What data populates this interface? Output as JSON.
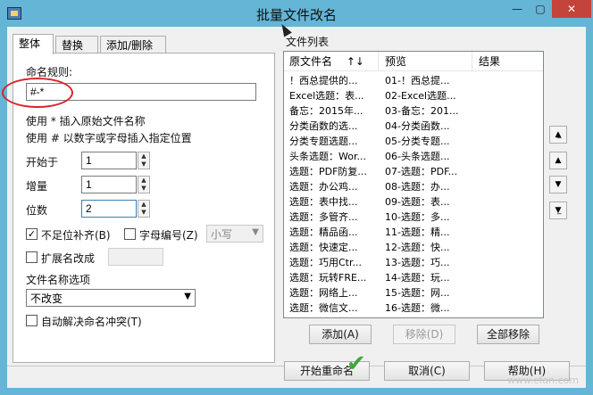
{
  "window": {
    "title": "批量文件改名",
    "min": "—",
    "max": "▢",
    "close": "✕"
  },
  "tabs": [
    "整体",
    "替换",
    "添加/删除"
  ],
  "left": {
    "rule_label": "命名规则:",
    "rule_value": "#-*",
    "hint1": "使用 * 插入原始文件名称",
    "hint2": "使用 # 以数字或字母插入指定位置",
    "start_label": "开始于",
    "start_value": "1",
    "step_label": "增量",
    "step_value": "1",
    "digits_label": "位数",
    "digits_value": "2",
    "pad_label": "不足位补齐(B)",
    "pad_checked": "✓",
    "alpha_label": "字母编号(Z)",
    "case_value": "小写",
    "ext_label": "扩展名改成",
    "ext_value": "",
    "name_opt_label": "文件名称选项",
    "name_opt_value": "不改变",
    "conflict_label": "自动解决命名冲突(T)"
  },
  "filelist": {
    "group_label": "文件列表",
    "headers": {
      "orig": "原文件名",
      "sort": "↑↓",
      "preview": "预览",
      "result": "结果"
    },
    "rows": [
      {
        "orig": "！西总提供的...",
        "preview": "01-！西总提..."
      },
      {
        "orig": "Excel选题：表...",
        "preview": "02-Excel选题..."
      },
      {
        "orig": "备忘：2015年...",
        "preview": "03-备忘：201..."
      },
      {
        "orig": "分类函数的选...",
        "preview": "04-分类函数..."
      },
      {
        "orig": "分类专题选题...",
        "preview": "05-分类专题..."
      },
      {
        "orig": "头条选题：Wor...",
        "preview": "06-头条选题..."
      },
      {
        "orig": "选题：PDF防复...",
        "preview": "07-选题：PDF..."
      },
      {
        "orig": "选题：办公鸡...",
        "preview": "08-选题：办..."
      },
      {
        "orig": "选题：表中找...",
        "preview": "09-选题：表..."
      },
      {
        "orig": "选题：多管齐...",
        "preview": "10-选题：多..."
      },
      {
        "orig": "选题：精品函...",
        "preview": "11-选题：精..."
      },
      {
        "orig": "选题：快速定...",
        "preview": "12-选题：快..."
      },
      {
        "orig": "选题：巧用Ctr...",
        "preview": "13-选题：巧..."
      },
      {
        "orig": "选题：玩转FRE...",
        "preview": "14-选题：玩..."
      },
      {
        "orig": "选题：网络上...",
        "preview": "15-选题：网..."
      },
      {
        "orig": "选题：微信文...",
        "preview": "16-选题：微..."
      }
    ],
    "add": "添加(A)",
    "remove": "移除(D)",
    "remove_all": "全部移除"
  },
  "side": {
    "top": "▲̲",
    "up": "▲",
    "down": "▼",
    "bottom": "▼̲"
  },
  "footer": {
    "start": "开始重命名",
    "cancel": "取消(C)",
    "help": "帮助(H)"
  },
  "watermark": "www.cfan.com"
}
